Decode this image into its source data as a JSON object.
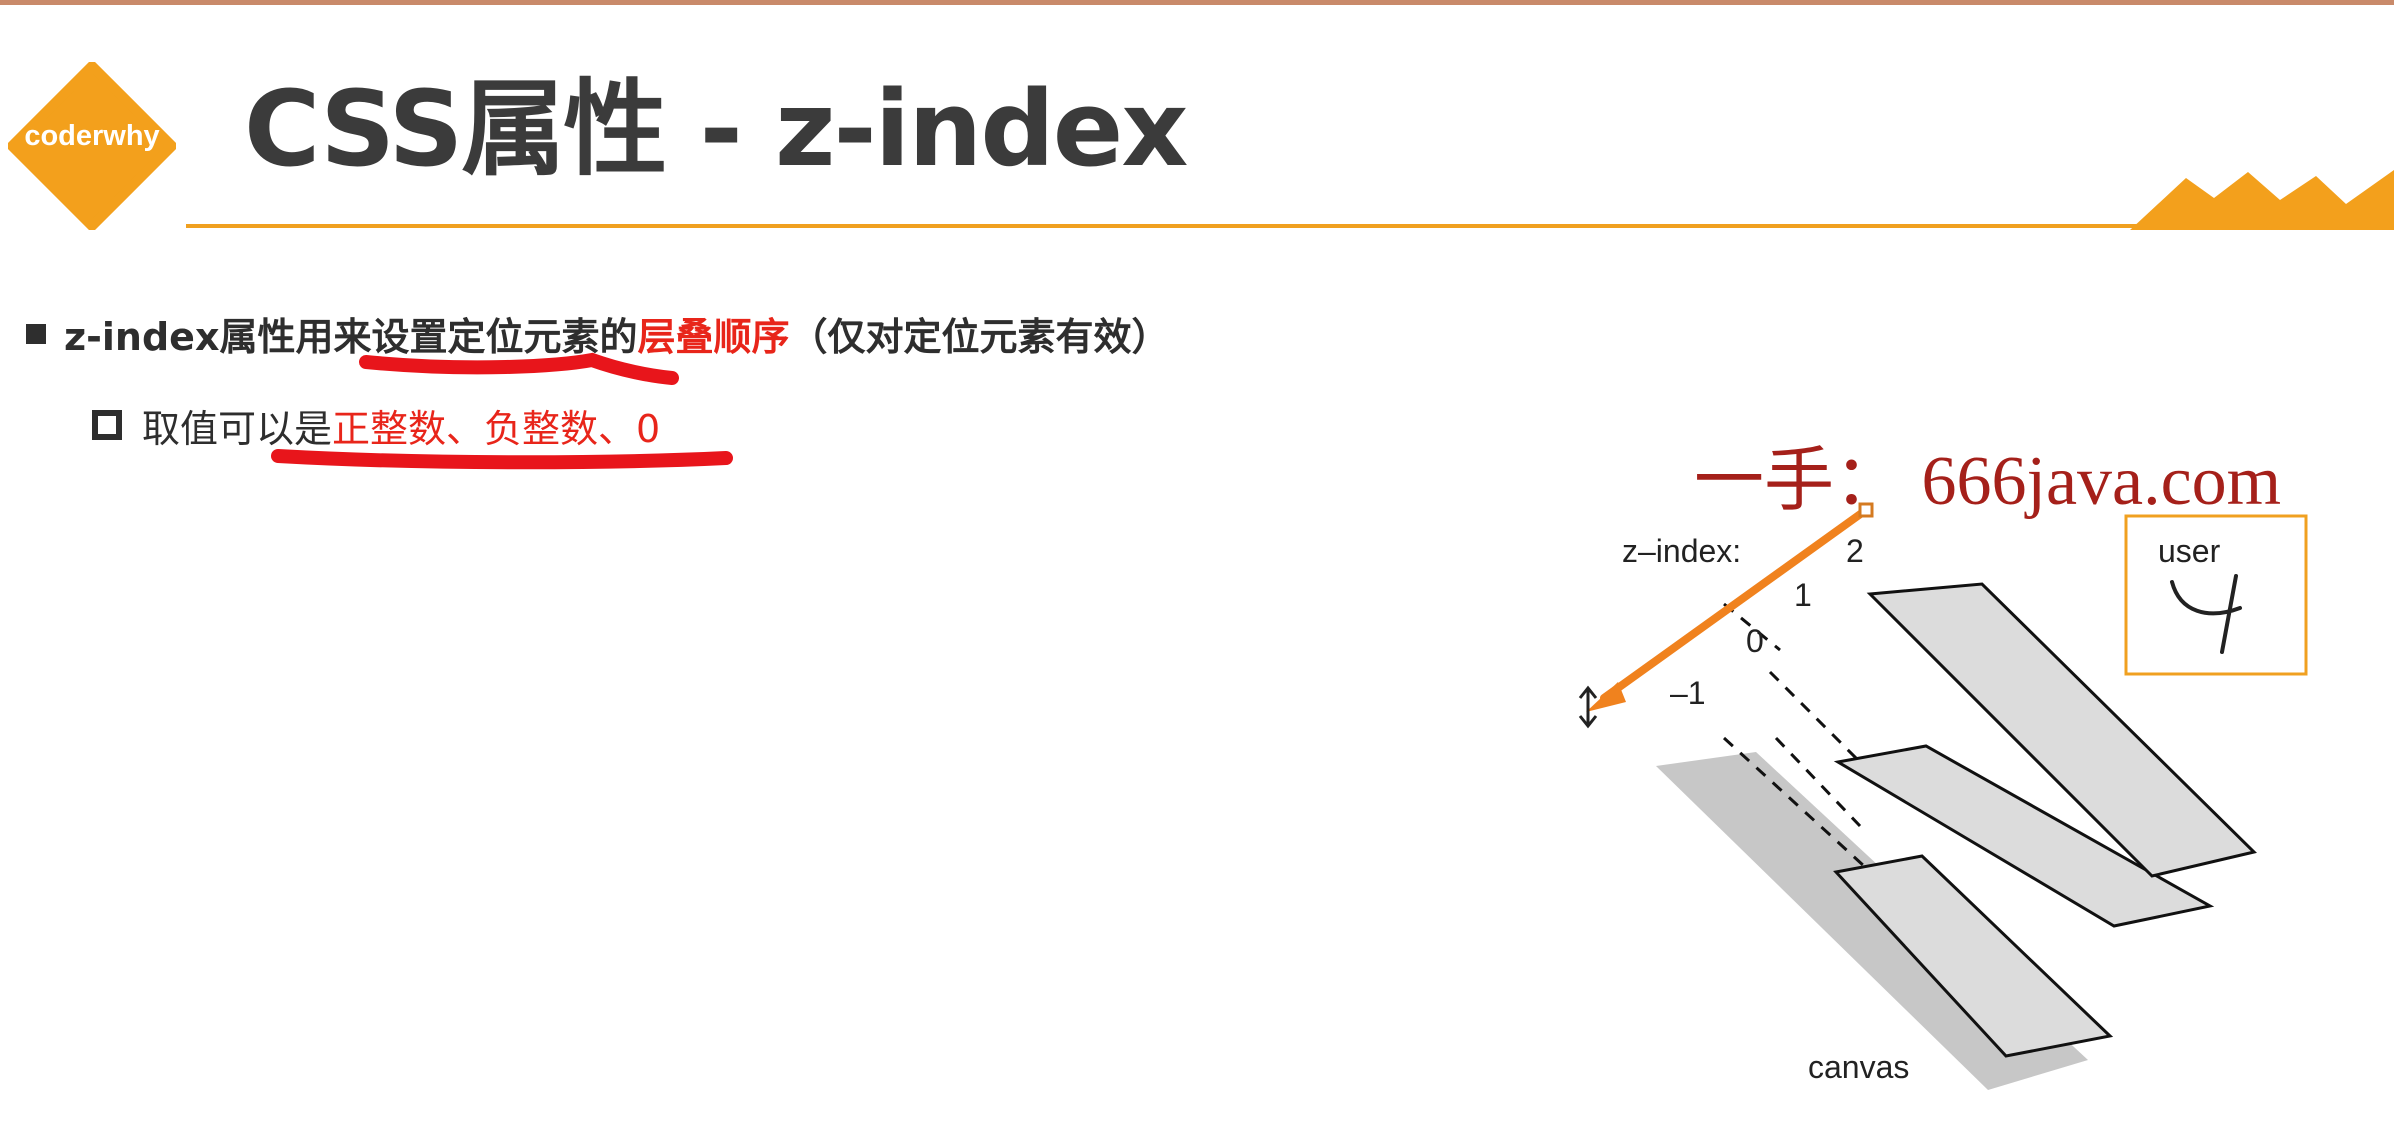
{
  "slide": {
    "logo_text": "coderwhy",
    "title": "CSS属性 - z-index",
    "colors": {
      "accent_orange": "#f0a020",
      "emphasis_red": "#e8251a",
      "text_dark": "#2e2e2e"
    }
  },
  "bullet1": {
    "part1": "z-index属性用来设置定位元素的",
    "emphasis": "层叠顺序",
    "part2": "（仅对定位元素有效）"
  },
  "bullet2": {
    "part1": "取值可以是",
    "emphasis": "正整数、负整数、0"
  },
  "watermark": "一手：  666java.com",
  "figure": {
    "z_label": "z–index:",
    "levels": [
      "2",
      "1",
      "0",
      "–1"
    ],
    "user_label": "user",
    "canvas_label": "canvas"
  }
}
